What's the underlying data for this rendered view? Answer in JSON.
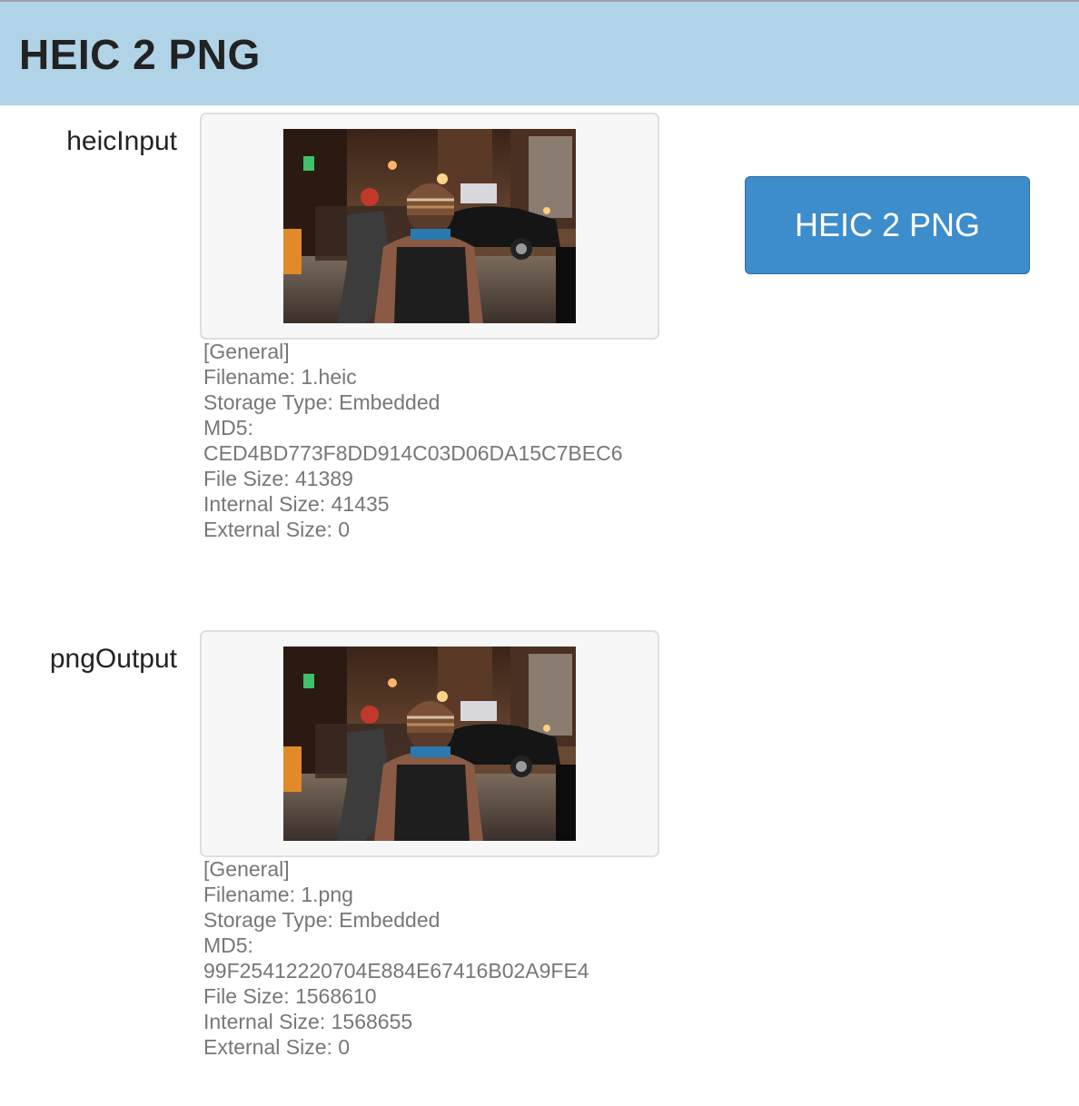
{
  "header": {
    "title": "HEIC 2 PNG"
  },
  "convert_button": {
    "label": "HEIC 2 PNG"
  },
  "input_section": {
    "label": "heicInput",
    "info": {
      "general": "[General]",
      "filename": "Filename: 1.heic",
      "storage_type": "Storage Type: Embedded",
      "md5_label": "MD5:",
      "md5_value": "CED4BD773F8DD914C03D06DA15C7BEC6",
      "file_size": "File Size: 41389",
      "internal_size": "Internal Size: 41435",
      "external_size": "External Size: 0"
    }
  },
  "output_section": {
    "label": "pngOutput",
    "info": {
      "general": "[General]",
      "filename": "Filename: 1.png",
      "storage_type": "Storage Type: Embedded",
      "md5_label": "MD5:",
      "md5_value": "99F25412220704E884E67416B02A9FE4",
      "file_size": "File Size: 1568610",
      "internal_size": "Internal Size: 1568655",
      "external_size": "External Size: 0"
    }
  },
  "colors": {
    "header_bg": "#b0d3e8",
    "button_bg": "#3d8ccb",
    "info_text": "#777777"
  }
}
